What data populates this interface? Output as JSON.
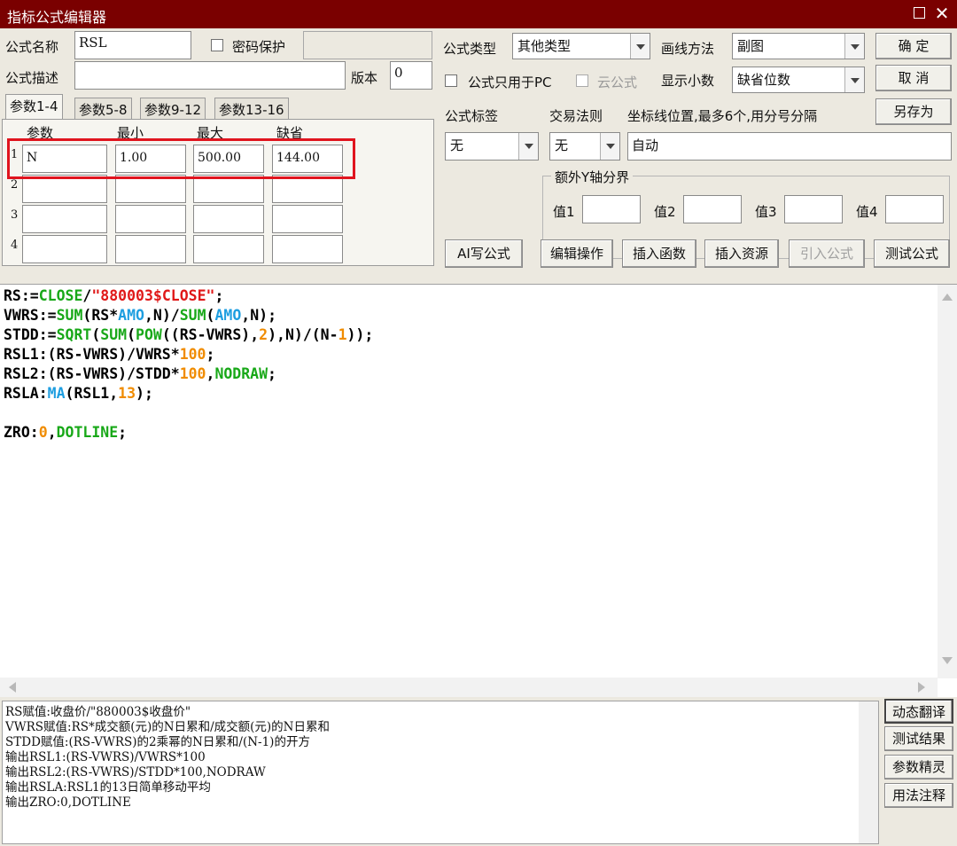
{
  "window": {
    "title": "指标公式编辑器"
  },
  "form": {
    "name_label": "公式名称",
    "name_value": "RSL",
    "password_label": "密码保护",
    "desc_label": "公式描述",
    "desc_value": "",
    "version_label": "版本",
    "version_value": "0",
    "type_label": "公式类型",
    "type_value": "其他类型",
    "draw_label": "画线方法",
    "draw_value": "副图",
    "pc_only_label": "公式只用于PC",
    "cloud_label": "云公式",
    "decimals_label": "显示小数",
    "decimals_value": "缺省位数",
    "tag_label": "公式标签",
    "tag_value": "无",
    "trade_label": "交易法则",
    "trade_value": "无",
    "coord_label": "坐标线位置,最多6个,用分号分隔",
    "coord_value": "自动",
    "yaxis_label": "额外Y轴分界",
    "yaxis_values": [
      {
        "label": "值1",
        "value": ""
      },
      {
        "label": "值2",
        "value": ""
      },
      {
        "label": "值3",
        "value": ""
      },
      {
        "label": "值4",
        "value": ""
      }
    ]
  },
  "buttons": {
    "ok": "确  定",
    "cancel": "取  消",
    "save_as": "另存为",
    "ai": "AI写公式",
    "edit_ops": "编辑操作",
    "insert_func": "插入函数",
    "insert_res": "插入资源",
    "import": "引入公式",
    "test": "测试公式"
  },
  "params": {
    "tabs": [
      "参数1-4",
      "参数5-8",
      "参数9-12",
      "参数13-16"
    ],
    "headers": [
      "参数",
      "最小",
      "最大",
      "缺省"
    ],
    "rows": [
      {
        "num": "1",
        "name": "N",
        "min": "1.00",
        "max": "500.00",
        "def": "144.00"
      },
      {
        "num": "2",
        "name": "",
        "min": "",
        "max": "",
        "def": ""
      },
      {
        "num": "3",
        "name": "",
        "min": "",
        "max": "",
        "def": ""
      },
      {
        "num": "4",
        "name": "",
        "min": "",
        "max": "",
        "def": ""
      }
    ]
  },
  "code": [
    [
      {
        "t": "RS:=",
        "c": ""
      },
      {
        "t": "CLOSE",
        "c": "green"
      },
      {
        "t": "/",
        "c": ""
      },
      {
        "t": "\"880003$CLOSE\"",
        "c": "red"
      },
      {
        "t": ";",
        "c": ""
      }
    ],
    [
      {
        "t": "VWRS:=",
        "c": ""
      },
      {
        "t": "SUM",
        "c": "green"
      },
      {
        "t": "(RS*",
        "c": ""
      },
      {
        "t": "AMO",
        "c": "blue"
      },
      {
        "t": ",N)/",
        "c": ""
      },
      {
        "t": "SUM",
        "c": "green"
      },
      {
        "t": "(",
        "c": ""
      },
      {
        "t": "AMO",
        "c": "blue"
      },
      {
        "t": ",N);",
        "c": ""
      }
    ],
    [
      {
        "t": "STDD:=",
        "c": ""
      },
      {
        "t": "SQRT",
        "c": "green"
      },
      {
        "t": "(",
        "c": ""
      },
      {
        "t": "SUM",
        "c": "green"
      },
      {
        "t": "(",
        "c": ""
      },
      {
        "t": "POW",
        "c": "green"
      },
      {
        "t": "((RS-VWRS),",
        "c": ""
      },
      {
        "t": "2",
        "c": "orange"
      },
      {
        "t": "),N)/(N-",
        "c": ""
      },
      {
        "t": "1",
        "c": "orange"
      },
      {
        "t": "));",
        "c": ""
      }
    ],
    [
      {
        "t": "RSL1:(RS-VWRS)/VWRS*",
        "c": ""
      },
      {
        "t": "100",
        "c": "orange"
      },
      {
        "t": ";",
        "c": ""
      }
    ],
    [
      {
        "t": "RSL2:(RS-VWRS)/STDD*",
        "c": ""
      },
      {
        "t": "100",
        "c": "orange"
      },
      {
        "t": ",",
        "c": ""
      },
      {
        "t": "NODRAW",
        "c": "green"
      },
      {
        "t": ";",
        "c": ""
      }
    ],
    [
      {
        "t": "RSLA:",
        "c": ""
      },
      {
        "t": "MA",
        "c": "blue"
      },
      {
        "t": "(RSL1,",
        "c": ""
      },
      {
        "t": "13",
        "c": "orange"
      },
      {
        "t": ");",
        "c": ""
      }
    ],
    [],
    [
      {
        "t": "ZRO:",
        "c": ""
      },
      {
        "t": "0",
        "c": "orange"
      },
      {
        "t": ",",
        "c": ""
      },
      {
        "t": "DOTLINE",
        "c": "green"
      },
      {
        "t": ";",
        "c": ""
      }
    ]
  ],
  "translation": [
    "RS赋值:收盘价/\"880003$收盘价\"",
    "VWRS赋值:RS*成交额(元)的N日累和/成交额(元)的N日累和",
    "STDD赋值:(RS-VWRS)的2乘幂的N日累和/(N-1)的开方",
    "输出RSL1:(RS-VWRS)/VWRS*100",
    "输出RSL2:(RS-VWRS)/STDD*100,NODRAW",
    "输出RSLA:RSL1的13日简单移动平均",
    "输出ZRO:0,DOTLINE"
  ],
  "side_buttons": [
    "动态翻译",
    "测试结果",
    "参数精灵",
    "用法注释"
  ]
}
